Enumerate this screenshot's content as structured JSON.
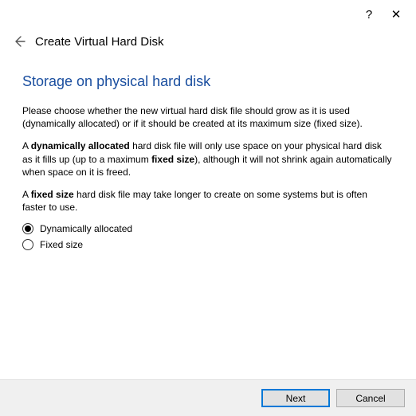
{
  "titlebar": {
    "help": "?",
    "close": "✕"
  },
  "header": {
    "title": "Create Virtual Hard Disk"
  },
  "page": {
    "heading": "Storage on physical hard disk",
    "p1": "Please choose whether the new virtual hard disk file should grow as it is used (dynamically allocated) or if it should be created at its maximum size (fixed size).",
    "p2_a": "A ",
    "p2_b1": "dynamically allocated",
    "p2_b": " hard disk file will only use space on your physical hard disk as it fills up (up to a maximum ",
    "p2_b2": "fixed size",
    "p2_c": "), although it will not shrink again automatically when space on it is freed.",
    "p3_a": "A ",
    "p3_b1": "fixed size",
    "p3_b": " hard disk file may take longer to create on some systems but is often faster to use."
  },
  "radios": {
    "dynamic": {
      "label": "Dynamically allocated",
      "selected": true
    },
    "fixed": {
      "label": "Fixed size",
      "selected": false
    }
  },
  "footer": {
    "next": "Next",
    "cancel": "Cancel"
  }
}
